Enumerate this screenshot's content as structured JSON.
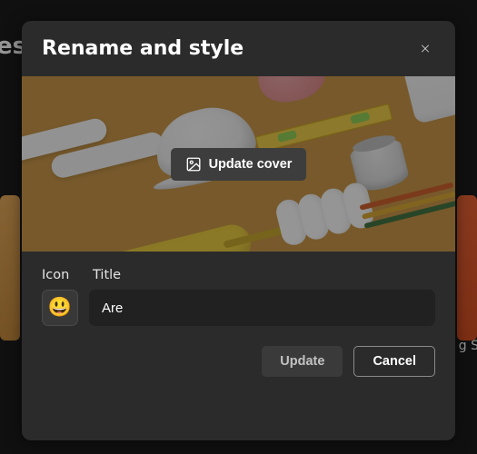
{
  "background": {
    "partial_heading": "es",
    "partial_label_right": "g S"
  },
  "dialog": {
    "title": "Rename and style",
    "cover": {
      "update_button_label": "Update cover"
    },
    "form": {
      "icon_label": "Icon",
      "title_label": "Title",
      "icon_emoji": "😃",
      "title_value": "Are"
    },
    "footer": {
      "update_label": "Update",
      "cancel_label": "Cancel"
    }
  }
}
